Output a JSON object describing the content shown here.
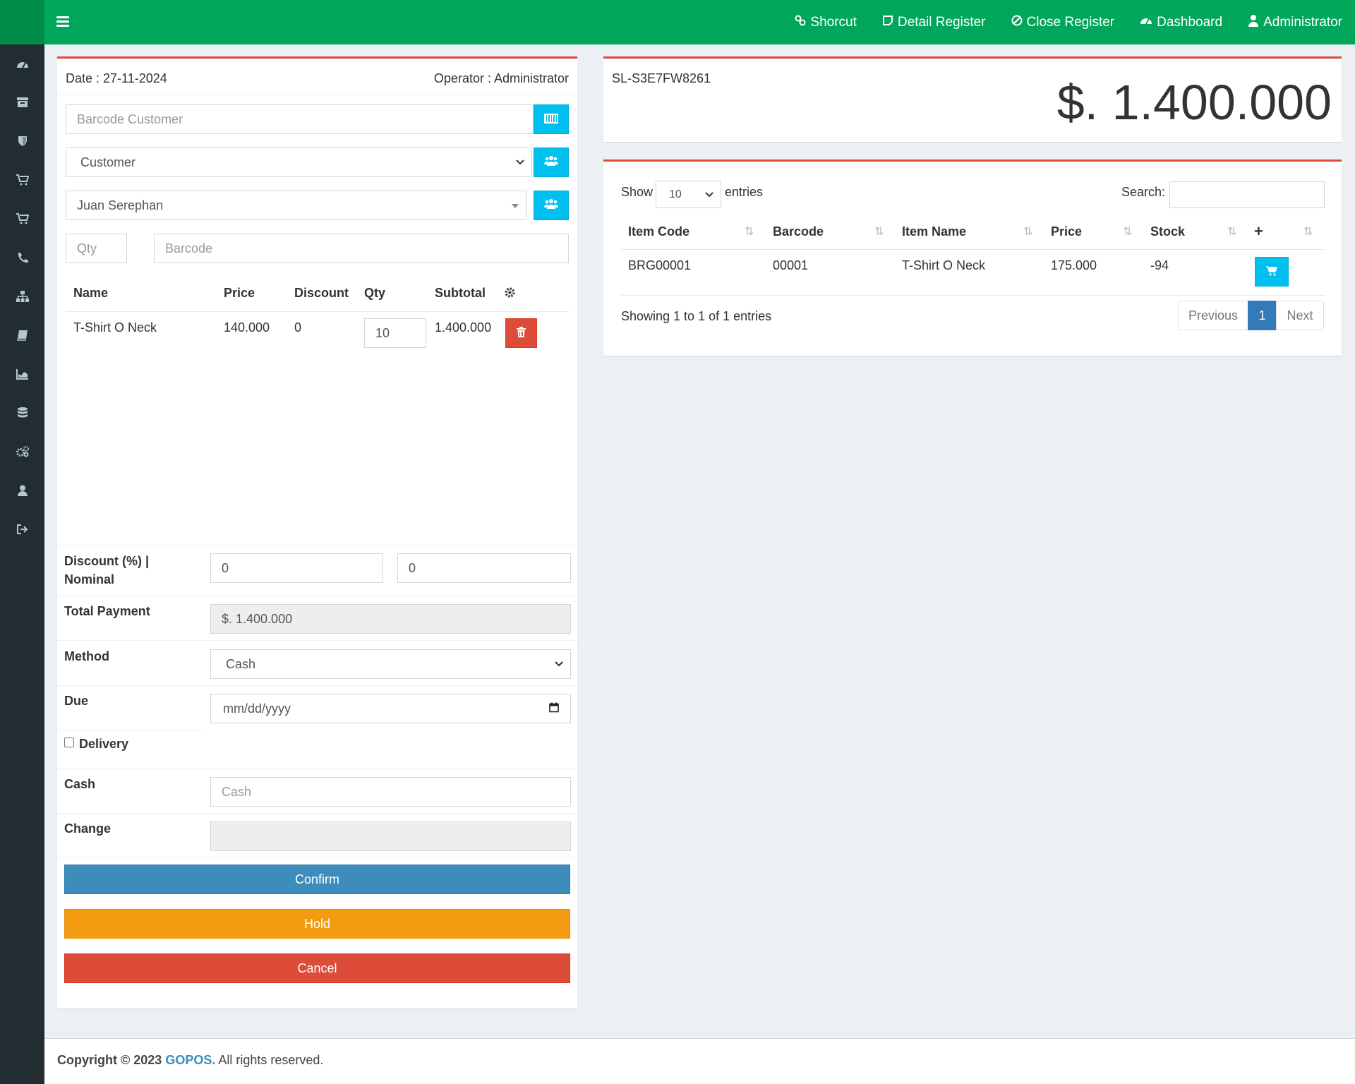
{
  "header": {
    "nav": [
      {
        "label": "Shorcut",
        "icon": "link-icon"
      },
      {
        "label": "Detail Register",
        "icon": "note-icon"
      },
      {
        "label": "Close Register",
        "icon": "ban-icon"
      },
      {
        "label": "Dashboard",
        "icon": "dashboard-icon"
      },
      {
        "label": "Administrator",
        "icon": "user-icon"
      }
    ]
  },
  "sidebar": {
    "items": [
      "dashboard-icon",
      "archive-icon",
      "shield-icon",
      "cart-icon",
      "cart-plus-icon",
      "phone-icon",
      "sitemap-icon",
      "book-icon",
      "chart-icon",
      "database-icon",
      "gears-icon",
      "user-icon",
      "sign-out-icon"
    ]
  },
  "sale": {
    "date_text": "Date : 27-11-2024",
    "operator_text": "Operator : Administrator",
    "barcode_customer_placeholder": "Barcode Customer",
    "customer_type": "Customer",
    "customer_name": "Juan Serephan",
    "qty_placeholder": "Qty",
    "barcode_placeholder": "Barcode",
    "cart_headers": {
      "name": "Name",
      "price": "Price",
      "discount": "Discount",
      "qty": "Qty",
      "subtotal": "Subtotal"
    },
    "cart_items": [
      {
        "name": "T-Shirt O Neck",
        "price": "140.000",
        "discount": "0",
        "qty": "10",
        "subtotal": "1.400.000"
      }
    ]
  },
  "payment": {
    "discount_label": "Discount (%) | Nominal",
    "discount_percent": "0",
    "discount_nominal": "0",
    "total_label": "Total Payment",
    "total_value": "$. 1.400.000",
    "method_label": "Method",
    "method_value": "Cash",
    "due_label": "Due",
    "due_placeholder": "mm/dd/yyyy",
    "delivery_label": "Delivery",
    "cash_label": "Cash",
    "cash_placeholder": "Cash",
    "change_label": "Change",
    "confirm_label": "Confirm",
    "hold_label": "Hold",
    "cancel_label": "Cancel"
  },
  "summary": {
    "invoice_no": "SL-S3E7FW8261",
    "grand_total": "$. 1.400.000"
  },
  "items_table": {
    "show_label": "Show",
    "page_size": "10",
    "entries_label": "entries",
    "search_label": "Search:",
    "headers": {
      "code": "Item Code",
      "barcode": "Barcode",
      "name": "Item Name",
      "price": "Price",
      "stock": "Stock",
      "add": "+"
    },
    "rows": [
      {
        "code": "BRG00001",
        "barcode": "00001",
        "name": "T-Shirt O Neck",
        "price": "175.000",
        "stock": "-94"
      }
    ],
    "info": "Showing 1 to 1 of 1 entries",
    "prev_label": "Previous",
    "page_label": "1",
    "next_label": "Next"
  },
  "footer": {
    "prefix": "Copyright © 2023",
    "brand": "GOPOS.",
    "suffix": "All rights reserved."
  },
  "colors": {
    "header": "#00a65a",
    "sidebar": "#222d32",
    "confirm": "#3c8dbc",
    "hold": "#f39c12",
    "cancel": "#dd4b39",
    "info_button": "#00c0ef"
  }
}
